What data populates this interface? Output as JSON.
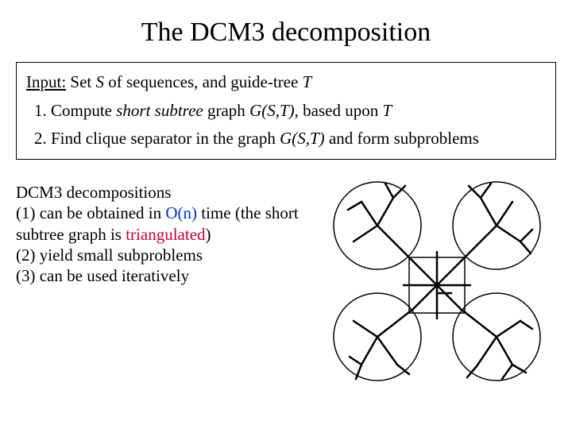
{
  "title": "The DCM3 decomposition",
  "algo": {
    "input_label": "Input:",
    "input_rest_1": " Set ",
    "input_S": "S",
    "input_rest_2": " of sequences, and guide-tree ",
    "input_T": "T",
    "step1_num": "1.",
    "step1_a": " Compute ",
    "step1_ital": "short subtree",
    "step1_b": " graph ",
    "step1_G": "G(S,T)",
    "step1_c": ", based upon ",
    "step1_T": "T",
    "step2_num": "2.",
    "step2_a": " Find clique separator in the graph ",
    "step2_G": "G(S,T)",
    "step2_b": " and form subproblems"
  },
  "desc": {
    "line1": "DCM3 decompositions",
    "line2a": "(1) can be obtained in ",
    "line2_on": "O(n)",
    "line2b": " time (the short subtree graph is ",
    "line2_tri": "triangulated",
    "line2c": ")",
    "line3": "(2) yield small subproblems",
    "line4": "(3) can be used iteratively"
  }
}
